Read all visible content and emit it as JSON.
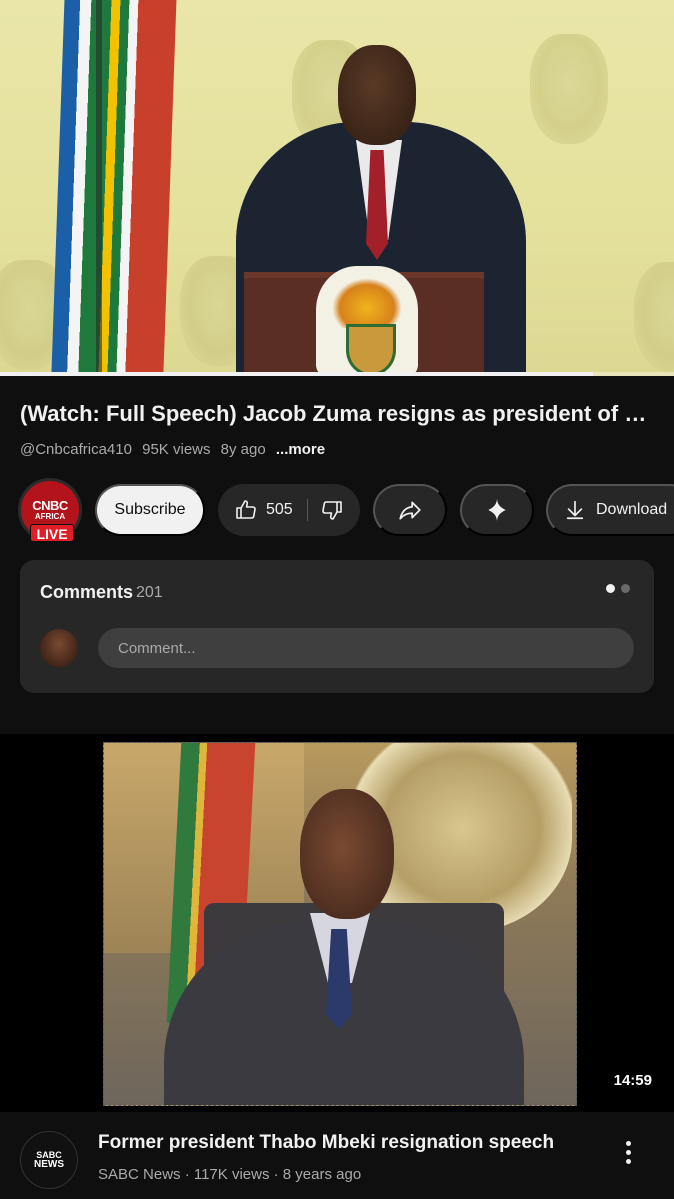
{
  "player": {
    "progress": 0.88
  },
  "video": {
    "title": "(Watch: Full Speech) Jacob Zuma resigns as president of So...",
    "channel_handle": "@Cnbcafrica410",
    "views": "95K views",
    "age": "8y ago",
    "more_label": "...more"
  },
  "channel": {
    "logo_text": "CNBC",
    "logo_sub": "AFRICA",
    "live_badge": "LIVE"
  },
  "actions": {
    "subscribe_label": "Subscribe",
    "like_count": "505",
    "download_label": "Download"
  },
  "comments": {
    "title": "Comments",
    "count": "201",
    "input_placeholder": "Comment..."
  },
  "recommended": {
    "duration": "14:59",
    "title": "Former president Thabo Mbeki resignation speech",
    "meta": "SABC News · 117K views · 8 years ago",
    "avatar_logo": "SABC",
    "avatar_logo_sub": "NEWS"
  },
  "icons": {
    "like": "thumbs-up-icon",
    "dislike": "thumbs-down-icon",
    "share": "share-icon",
    "ask": "sparkle-icon",
    "download": "download-icon",
    "overflow": "more-vert-icon"
  },
  "colors": {
    "background": "#0f0f0f",
    "surface": "#272727",
    "live_red": "#e01e27"
  }
}
